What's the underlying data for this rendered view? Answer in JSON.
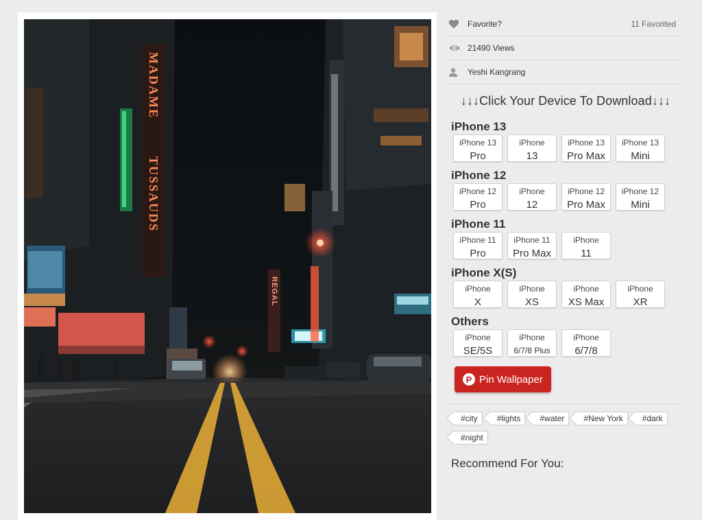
{
  "meta": {
    "favorite_label": "Favorite?",
    "favorited_count": "11 Favorited",
    "views": "21490 Views",
    "author": "Yeshi Kangrang"
  },
  "download_title": "↓↓↓Click Your Device To Download↓↓↓",
  "groups": [
    {
      "title": "iPhone 13",
      "devices": [
        {
          "l1": "iPhone 13",
          "l2": "Pro"
        },
        {
          "l1": "iPhone",
          "l2": "13"
        },
        {
          "l1": "iPhone 13",
          "l2": "Pro Max"
        },
        {
          "l1": "iPhone 13",
          "l2": "Mini"
        }
      ]
    },
    {
      "title": "iPhone 12",
      "devices": [
        {
          "l1": "iPhone 12",
          "l2": "Pro"
        },
        {
          "l1": "iPhone",
          "l2": "12"
        },
        {
          "l1": "iPhone 12",
          "l2": "Pro Max"
        },
        {
          "l1": "iPhone 12",
          "l2": "Mini"
        }
      ]
    },
    {
      "title": "iPhone 11",
      "devices": [
        {
          "l1": "iPhone 11",
          "l2": "Pro"
        },
        {
          "l1": "iPhone 11",
          "l2": "Pro Max"
        },
        {
          "l1": "iPhone",
          "l2": "11"
        }
      ]
    },
    {
      "title": "iPhone X(S)",
      "devices": [
        {
          "l1": "iPhone",
          "l2": "X"
        },
        {
          "l1": "iPhone",
          "l2": "XS"
        },
        {
          "l1": "iPhone",
          "l2": "XS Max"
        },
        {
          "l1": "iPhone",
          "l2": "XR"
        }
      ]
    },
    {
      "title": "Others",
      "devices": [
        {
          "l1": "iPhone",
          "l2": "SE/5S"
        },
        {
          "l1": "iPhone",
          "l2": "6/7/8 Plus"
        },
        {
          "l1": "iPhone",
          "l2": "6/7/8"
        }
      ]
    }
  ],
  "pin_button": "Pin Wallpaper",
  "tags": [
    "#city",
    "#lights",
    "#water",
    "#New York",
    "#dark",
    "#night"
  ],
  "recommend_title": "Recommend For You:",
  "photo_signs": {
    "madame": "MADAME",
    "tussauds": "TUSSAUDS",
    "regal": "REGAL"
  },
  "colors": {
    "pin": "#c9241f",
    "background": "#ececec"
  }
}
